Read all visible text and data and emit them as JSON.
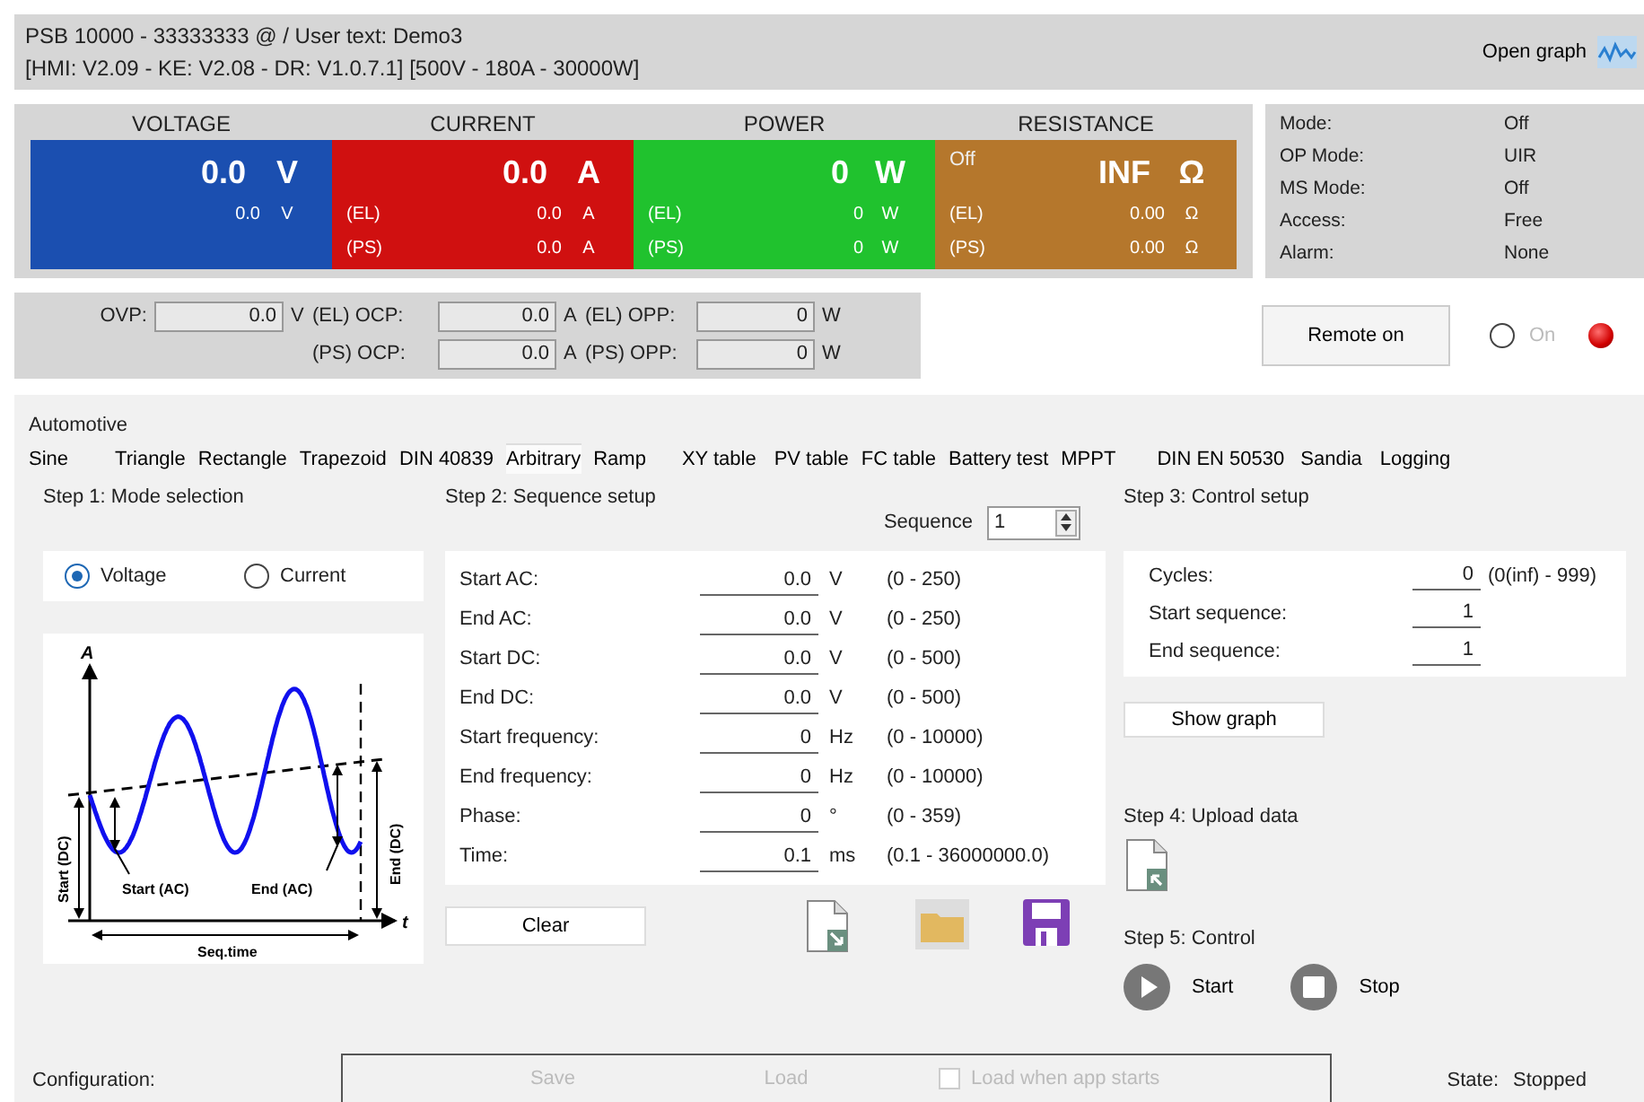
{
  "header": {
    "title": "PSB 10000 - 33333333 @ / User text: Demo3",
    "subtitle": "[HMI: V2.09 - KE: V2.08 - DR: V1.0.7.1] [500V - 180A - 30000W]",
    "graph_button": "Open graph"
  },
  "meters": [
    {
      "heading": "VOLTAGE",
      "color": "#1b4fb0",
      "value": "0.0",
      "unit": "V",
      "rows": [
        {
          "value": "0.0",
          "unit": "V"
        }
      ]
    },
    {
      "heading": "CURRENT",
      "color": "#d01010",
      "value": "0.0",
      "unit": "A",
      "rows": [
        {
          "label": "(EL)",
          "value": "0.0",
          "unit": "A"
        },
        {
          "label": "(PS)",
          "value": "0.0",
          "unit": "A"
        }
      ]
    },
    {
      "heading": "POWER",
      "color": "#20c22e",
      "value": "0",
      "unit": "W",
      "rows": [
        {
          "label": "(EL)",
          "value": "0",
          "unit": "W"
        },
        {
          "label": "(PS)",
          "value": "0",
          "unit": "W"
        }
      ]
    },
    {
      "heading": "RESISTANCE",
      "color": "#b5772c",
      "status": "Off",
      "value": "INF",
      "unit": "Ω",
      "rows": [
        {
          "label": "(EL)",
          "value": "0.00",
          "unit": "Ω"
        },
        {
          "label": "(PS)",
          "value": "0.00",
          "unit": "Ω"
        }
      ]
    }
  ],
  "status": [
    {
      "label": "Mode:",
      "value": "Off"
    },
    {
      "label": "OP Mode:",
      "value": "UIR"
    },
    {
      "label": "MS Mode:",
      "value": "Off"
    },
    {
      "label": "Access:",
      "value": "Free"
    },
    {
      "label": "Alarm:",
      "value": "None"
    }
  ],
  "protection": [
    [
      {
        "label": "OVP:",
        "value": "0.0",
        "unit": "V"
      }
    ],
    [
      {
        "label": "(EL) OCP:",
        "value": "0.0",
        "unit": "A"
      },
      {
        "label": "(PS) OCP:",
        "value": "0.0",
        "unit": "A"
      }
    ],
    [
      {
        "label": "(EL) OPP:",
        "value": "0",
        "unit": "W"
      },
      {
        "label": "(PS) OPP:",
        "value": "0",
        "unit": "W"
      }
    ]
  ],
  "remote": {
    "button": "Remote on",
    "on_label": "On",
    "on_selected": false,
    "led_on": true
  },
  "section": "Automotive",
  "tabs": [
    {
      "label": "Sine",
      "selected": false
    },
    {
      "label": "Triangle",
      "selected": false
    },
    {
      "label": "Rectangle",
      "selected": false
    },
    {
      "label": "Trapezoid",
      "selected": false
    },
    {
      "label": "DIN 40839",
      "selected": false
    },
    {
      "label": "Arbitrary",
      "selected": true
    },
    {
      "label": "Ramp",
      "selected": false
    },
    {
      "label": "XY table",
      "selected": false
    },
    {
      "label": "PV table",
      "selected": false
    },
    {
      "label": "FC table",
      "selected": false
    },
    {
      "label": "Battery test",
      "selected": false
    },
    {
      "label": "MPPT",
      "selected": false
    },
    {
      "label": "DIN EN 50530",
      "selected": false
    },
    {
      "label": "Sandia",
      "selected": false
    },
    {
      "label": "Logging",
      "selected": false
    }
  ],
  "step1": {
    "title": "Step 1: Mode selection",
    "modes": [
      {
        "label": "Voltage",
        "selected": true
      },
      {
        "label": "Current",
        "selected": false
      }
    ],
    "diagram": {
      "y_axis": "A",
      "x_axis": "t",
      "start_dc": "Start (DC)",
      "end_dc": "End (DC)",
      "start_ac": "Start (AC)",
      "end_ac": "End (AC)",
      "seq_time": "Seq.time"
    }
  },
  "step2": {
    "title": "Step 2: Sequence setup",
    "sequence": {
      "label": "Sequence",
      "value": "1"
    },
    "params": [
      {
        "label": "Start AC:",
        "value": "0.0",
        "unit": "V",
        "range": "(0 - 250)"
      },
      {
        "label": "End AC:",
        "value": "0.0",
        "unit": "V",
        "range": "(0 - 250)"
      },
      {
        "label": "Start DC:",
        "value": "0.0",
        "unit": "V",
        "range": "(0 - 500)"
      },
      {
        "label": "End DC:",
        "value": "0.0",
        "unit": "V",
        "range": "(0 - 500)"
      },
      {
        "label": "Start frequency:",
        "value": "0",
        "unit": "Hz",
        "range": "(0 - 10000)"
      },
      {
        "label": "End frequency:",
        "value": "0",
        "unit": "Hz",
        "range": "(0 - 10000)"
      },
      {
        "label": "Phase:",
        "value": "0",
        "unit": "°",
        "range": "(0 - 359)"
      },
      {
        "label": "Time:",
        "value": "0.1",
        "unit": "ms",
        "range": "(0.1 - 36000000.0)"
      }
    ],
    "clear_button": "Clear"
  },
  "step3": {
    "title": "Step 3: Control setup",
    "fields": [
      {
        "label": "Cycles:",
        "value": "0",
        "range": "(0(inf) - 999)"
      },
      {
        "label": "Start sequence:",
        "value": "1"
      },
      {
        "label": "End sequence:",
        "value": "1"
      }
    ],
    "graph_button": "Show graph"
  },
  "step4": {
    "title": "Step 4: Upload data"
  },
  "step5": {
    "title": "Step 5: Control",
    "start": "Start",
    "stop": "Stop"
  },
  "config": {
    "label": "Configuration:",
    "save": "Save",
    "load": "Load",
    "autoload": {
      "label": "Load when app starts",
      "checked": false
    },
    "disabled": true
  },
  "state": {
    "label": "State:",
    "value": "Stopped"
  }
}
